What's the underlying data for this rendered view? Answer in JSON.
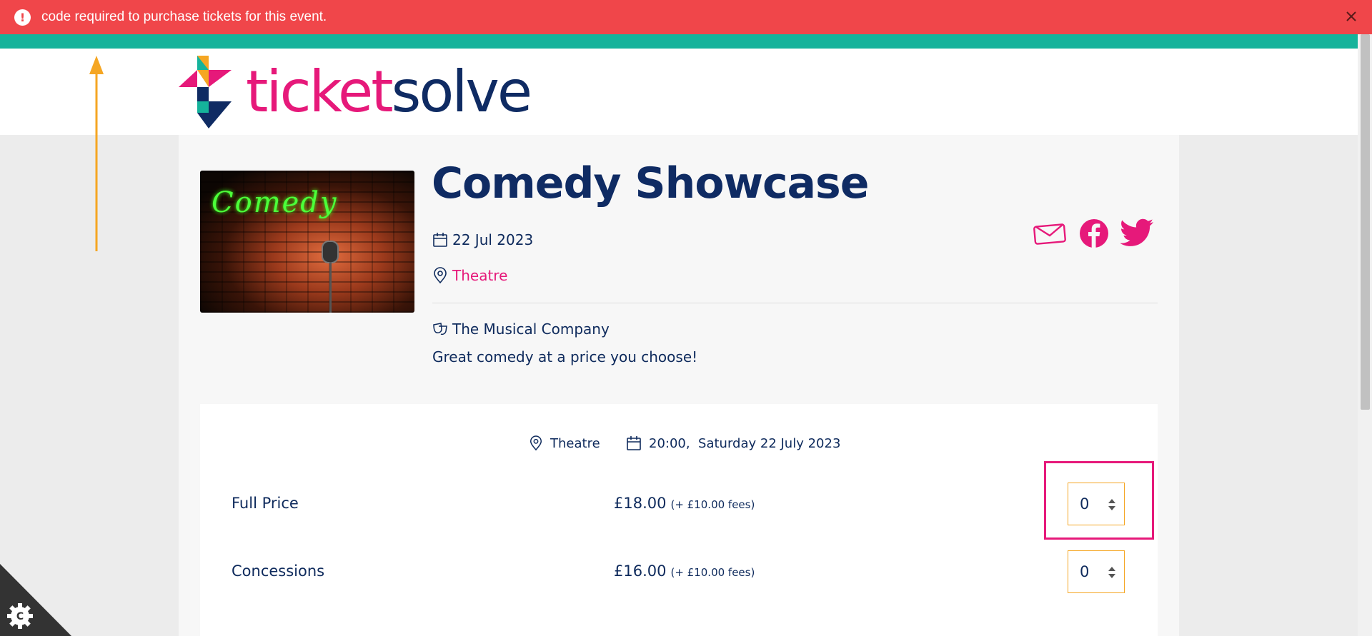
{
  "alert": {
    "message": "code required to purchase tickets for this event.",
    "icon": "exclamation-circle-icon",
    "close_icon": "close-icon",
    "color": "#f0464a"
  },
  "brand": {
    "name_part1": "ticket",
    "name_part2": "solve",
    "pink": "#e6197a",
    "navy": "#0f2b63",
    "teal": "#15b39b",
    "orange": "#f5a623"
  },
  "event": {
    "title": "Comedy Showcase",
    "date": "22 Jul 2023",
    "venue": "Theatre",
    "organiser": "The Musical Company",
    "description": "Great comedy at a price you choose!",
    "image_neon_text": "Comedy"
  },
  "share": {
    "email_icon": "email-icon",
    "facebook_icon": "facebook-icon",
    "twitter_icon": "twitter-icon"
  },
  "performance": {
    "venue": "Theatre",
    "datetime": "20:00,  Saturday 22 July 2023"
  },
  "tickets": [
    {
      "name": "Full Price",
      "price": "£18.00",
      "fees": "(+ £10.00 fees)",
      "quantity": "0"
    },
    {
      "name": "Concessions",
      "price": "£16.00",
      "fees": "(+ £10.00 fees)",
      "quantity": "0"
    }
  ],
  "cookie": {
    "icon": "cookie-settings-icon",
    "letter": "C"
  }
}
